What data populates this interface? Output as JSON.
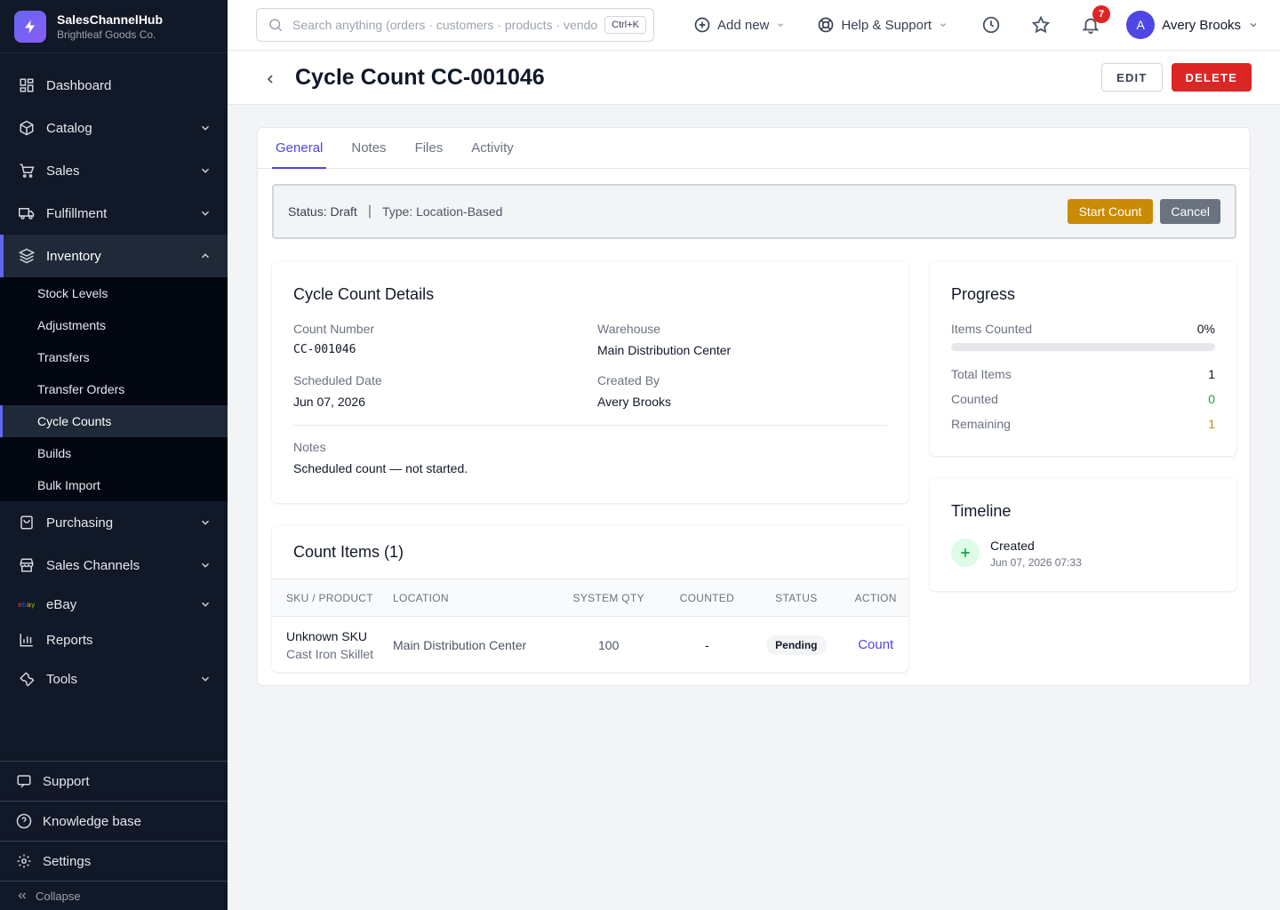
{
  "app": {
    "name": "SalesChannelHub",
    "company": "Brightleaf Goods Co."
  },
  "sidebar": {
    "items": [
      {
        "label": "Dashboard",
        "icon": "dashboard-icon"
      },
      {
        "label": "Catalog",
        "icon": "box-icon"
      },
      {
        "label": "Sales",
        "icon": "cart-icon"
      },
      {
        "label": "Fulfillment",
        "icon": "truck-icon"
      },
      {
        "label": "Inventory",
        "icon": "layers-icon"
      }
    ],
    "inventory_sub": [
      "Stock Levels",
      "Adjustments",
      "Transfers",
      "Transfer Orders",
      "Cycle Counts",
      "Builds",
      "Bulk Import"
    ],
    "items_after": [
      {
        "label": "Purchasing",
        "icon": "bag-icon"
      },
      {
        "label": "Sales Channels",
        "icon": "store-icon"
      },
      {
        "label": "eBay",
        "icon": "ebay-icon"
      },
      {
        "label": "Reports",
        "icon": "chart-icon"
      },
      {
        "label": "Tools",
        "icon": "wrench-icon"
      }
    ],
    "bottom": {
      "support": "Support",
      "knowledge": "Knowledge base",
      "settings": "Settings",
      "collapse": "Collapse"
    },
    "ebay_logo": "ebay"
  },
  "topbar": {
    "search_placeholder": "Search anything (orders · customers · products · vendors)",
    "shortcut": "Ctrl+K",
    "add_new": "Add new",
    "help": "Help & Support",
    "notifications": "7",
    "user_initial": "A",
    "user_name": "Avery Brooks"
  },
  "page": {
    "title": "Cycle Count CC-001046",
    "edit": "EDIT",
    "delete": "DELETE"
  },
  "tabs": [
    "General",
    "Notes",
    "Files",
    "Activity"
  ],
  "status_bar": {
    "status": "Status: Draft",
    "separator": "|",
    "type": "Type: Location-Based",
    "start": "Start Count",
    "cancel": "Cancel"
  },
  "details": {
    "heading": "Cycle Count Details",
    "count_number_label": "Count Number",
    "count_number": "CC-001046",
    "warehouse_label": "Warehouse",
    "warehouse": "Main Distribution Center",
    "scheduled_label": "Scheduled Date",
    "scheduled": "Jun 07, 2026",
    "created_by_label": "Created By",
    "created_by": "Avery Brooks",
    "notes_label": "Notes",
    "notes": "Scheduled count — not started."
  },
  "items": {
    "heading": "Count Items (1)",
    "columns": [
      "SKU / PRODUCT",
      "LOCATION",
      "SYSTEM QTY",
      "COUNTED",
      "STATUS",
      "ACTION"
    ],
    "rows": [
      {
        "sku": "Unknown SKU",
        "product": "Cast Iron Skillet",
        "location": "Main Distribution Center",
        "system_qty": "100",
        "counted": "-",
        "status": "Pending",
        "action": "Count"
      }
    ]
  },
  "progress": {
    "heading": "Progress",
    "items_counted_label": "Items Counted",
    "percent": "0%",
    "fraction": 0,
    "total_label": "Total Items",
    "total": "1",
    "counted_label": "Counted",
    "counted": "0",
    "remaining_label": "Remaining",
    "remaining": "1"
  },
  "timeline": {
    "heading": "Timeline",
    "events": [
      {
        "title": "Created",
        "date": "Jun 07, 2026 07:33"
      }
    ]
  },
  "colors": {
    "accent": "#4f46e5",
    "danger": "#dc2626",
    "warning": "#ca8a04",
    "success": "#16a34a",
    "sidebar": "#111827"
  }
}
